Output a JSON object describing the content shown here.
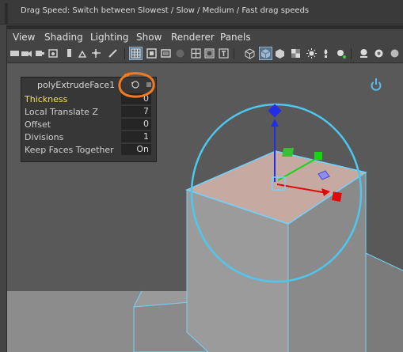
{
  "helpline": {
    "text": "Drag Speed: Switch between Slowest / Slow / Medium / Fast drag speeds"
  },
  "menu": [
    "View",
    "Shading",
    "Lighting",
    "Show",
    "Renderer",
    "Panels"
  ],
  "channel_box": {
    "title": "polyExtrudeFace1",
    "rows": [
      {
        "label": "Thickness",
        "value": "0",
        "active": true
      },
      {
        "label": "Local Translate Z",
        "value": "7"
      },
      {
        "label": "Offset",
        "value": "0"
      },
      {
        "label": "Divisions",
        "value": "1"
      },
      {
        "label": "Keep Faces Together",
        "value": "On"
      }
    ]
  },
  "colors": {
    "highlight_wire": "#6fd3ff",
    "active_label": "#f0e14a",
    "annotation": "#f07b22",
    "axis_x": "#e01010",
    "axis_y": "#10d010",
    "axis_z": "#1020e0"
  }
}
